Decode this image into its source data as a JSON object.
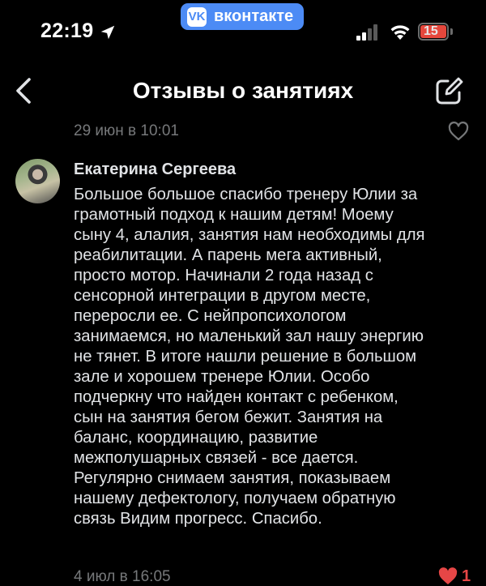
{
  "status_bar": {
    "time": "22:19",
    "app_badge": "вконтакте",
    "app_badge_logo": "VK",
    "battery_level": "15",
    "colors": {
      "badge": "#4c8bf5",
      "battery": "#e5473c"
    }
  },
  "header": {
    "title": "Отзывы о занятиях",
    "back_icon": "chevron-left-icon",
    "edit_icon": "edit-icon"
  },
  "post": {
    "date": "29 июн в 10:01",
    "like_icon": "heart-outline-icon"
  },
  "review": {
    "author": "Екатерина Сергеева",
    "text": "Большое большое спасибо тренеру Юлии за\nграмотный подход к нашим детям! Моему\nсыну 4, алалия, занятия нам необходимы для\nреабилитации. А парень мега активный,\nпросто мотор. Начинали 2 года назад с\nсенсорной интеграции в другом месте,\nпереросли ее. С нейпропсихологом\nзанимаемся, но маленький зал нашу энергию\nне тянет. В итоге нашли решение в большом\nзале и хорошем тренере Юлии.  Особо\nподчеркну что найден контакт с ребенком,\nсын на занятия бегом бежит. Занятия на\nбаланс, координацию, развитие\nмежполушарных связей - все дается.\nРегулярно снимаем занятия, показываем\nнашему дефектологу, получаем обратную\nсвязь Видим прогресс. Спасибо.",
    "date": "4 июл в 16:05",
    "likes": "1",
    "like_color": "#e64646"
  }
}
